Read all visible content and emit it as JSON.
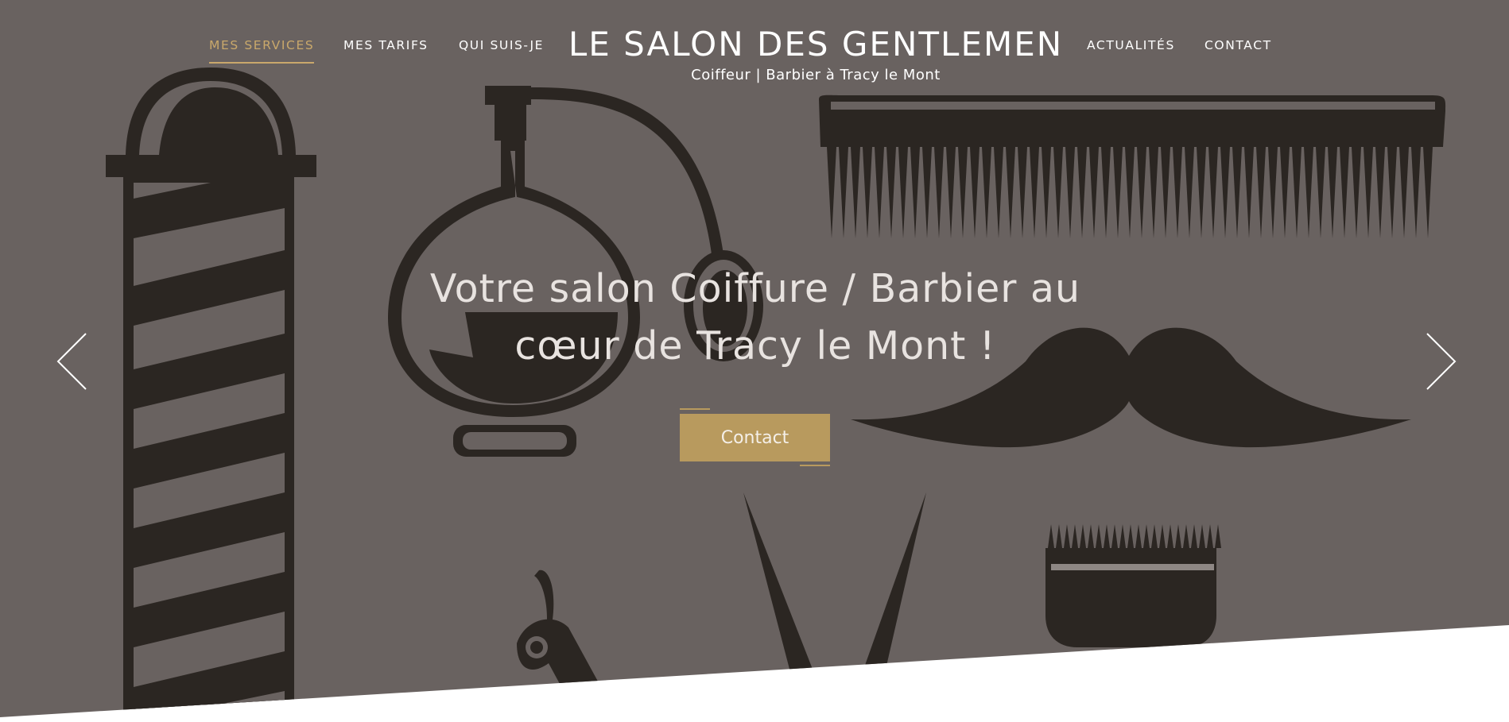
{
  "nav": {
    "left": [
      {
        "label": "MES SERVICES",
        "active": true
      },
      {
        "label": "MES TARIFS",
        "active": false
      },
      {
        "label": "QUI SUIS-JE",
        "active": false
      }
    ],
    "right": [
      {
        "label": "ACTUALITÉS",
        "active": false
      },
      {
        "label": "CONTACT",
        "active": false
      }
    ]
  },
  "brand": {
    "title": "LE SALON DES GENTLEMEN",
    "subtitle": "Coiffeur | Barbier à Tracy le Mont"
  },
  "hero": {
    "headline_line1": "Votre salon Coiffure / Barbier au",
    "headline_line2": "cœur de Tracy le Mont !",
    "cta_label": "Contact",
    "prev_icon": "chevron-left-icon",
    "next_icon": "chevron-right-icon"
  },
  "colors": {
    "background": "#696260",
    "illustration": "#2b2622",
    "accent": "#c9a86b",
    "button": "#b89a5e",
    "text": "#ffffff"
  }
}
